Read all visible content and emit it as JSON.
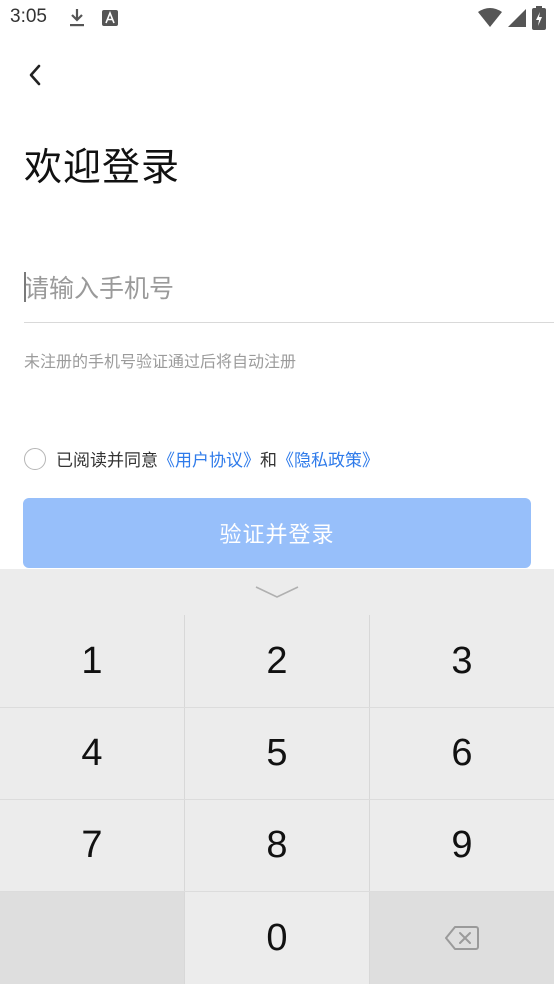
{
  "status_bar": {
    "time": "3:05"
  },
  "page": {
    "title": "欢迎登录"
  },
  "phone_input": {
    "placeholder": "请输入手机号",
    "value": ""
  },
  "hint": "未注册的手机号验证通过后将自动注册",
  "agreement": {
    "prefix": "已阅读并同意",
    "user_agreement": "《用户协议》",
    "conjunction": "和",
    "privacy_policy": "《隐私政策》",
    "link_color": "#2f7bea"
  },
  "login_button": {
    "label": "验证并登录",
    "color": "#97bffa"
  },
  "keyboard": {
    "keys": [
      "1",
      "2",
      "3",
      "4",
      "5",
      "6",
      "7",
      "8",
      "9",
      "",
      "0",
      "⌫"
    ],
    "delete_icon": "backspace-icon",
    "collapse_icon": "chevron-down-icon"
  }
}
